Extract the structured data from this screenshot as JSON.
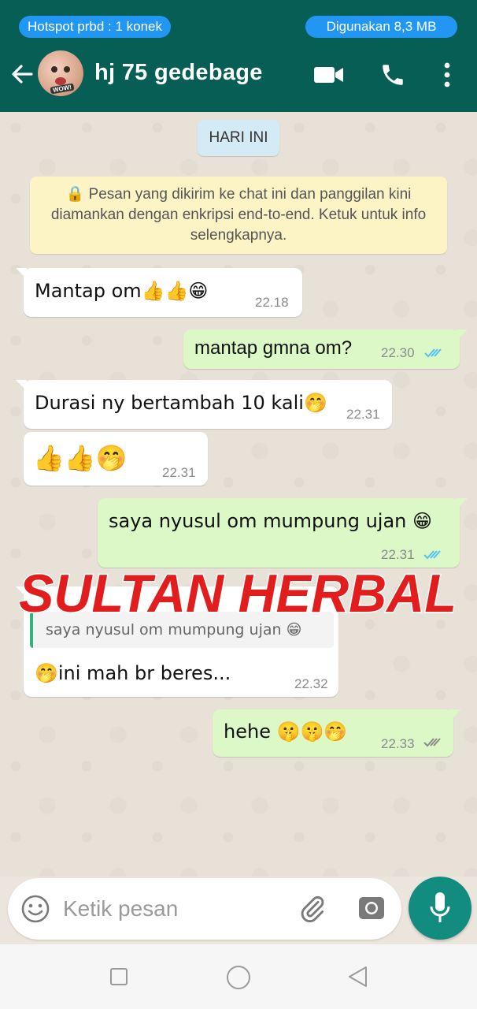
{
  "status_bar": {
    "hotspot": "Hotspot prbd : 1 konek",
    "data_usage": "Digunakan 8,3 MB"
  },
  "header": {
    "contact_name": "hj 75 gedebage",
    "avatar_badge": "WOW!"
  },
  "chat": {
    "date_chip": "HARI INI",
    "encryption_notice": "🔒 Pesan yang dikirim ke chat ini dan panggilan kini diamankan dengan enkripsi end-to-end. Ketuk untuk info selengkapnya.",
    "messages": [
      {
        "direction": "in",
        "text": "Mantap om👍👍😁",
        "time": "22.18"
      },
      {
        "direction": "out",
        "text": "mantap gmna om?",
        "time": "22.30",
        "status": "read"
      },
      {
        "direction": "in",
        "text": "Durasi ny bertambah 10 kali🤭",
        "time": "22.31"
      },
      {
        "direction": "in",
        "text": "👍👍🤭",
        "time": "22.31"
      },
      {
        "direction": "out",
        "text": "saya nyusul om mumpung ujan 😁",
        "time": "22.31",
        "status": "read"
      },
      {
        "direction": "in",
        "quoted": "saya nyusul om mumpung ujan 😁",
        "text": "🤭ini mah br beres...",
        "time": "22.32"
      },
      {
        "direction": "out",
        "text": "hehe 🤫🤫🤭",
        "time": "22.33",
        "status": "delivered"
      }
    ],
    "watermark": "SULTAN HERBAL"
  },
  "composer": {
    "placeholder": "Ketik pesan"
  },
  "colors": {
    "header": "#075e54",
    "accent": "#128c7e",
    "outgoing_bubble": "#dcf8c6",
    "incoming_bubble": "#ffffff",
    "read_ticks": "#4fc3f7",
    "watermark": "#e11d1d"
  },
  "icons": [
    "back-arrow-icon",
    "video-call-icon",
    "phone-icon",
    "more-vert-icon",
    "emoji-icon",
    "attach-icon",
    "camera-icon",
    "mic-icon",
    "square-nav-icon",
    "circle-nav-icon",
    "triangle-nav-icon"
  ]
}
